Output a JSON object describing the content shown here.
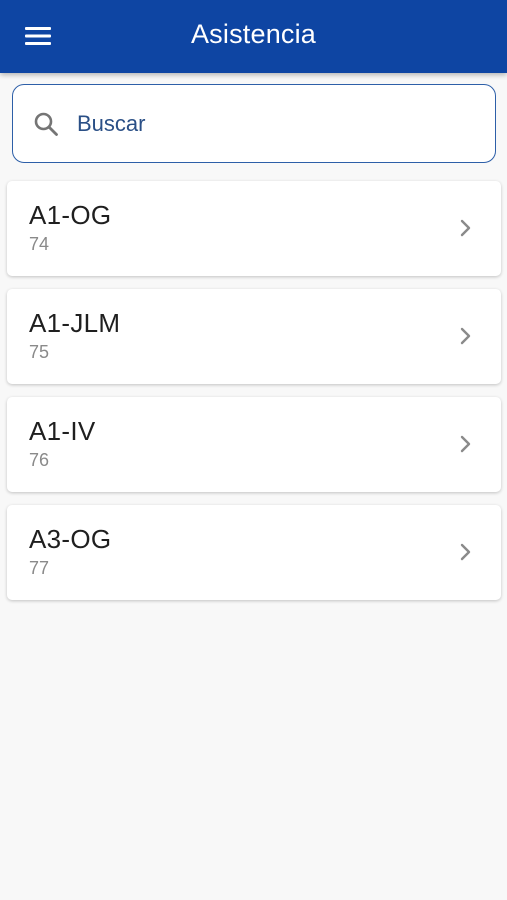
{
  "header": {
    "title": "Asistencia",
    "menu_icon": "hamburger-menu-icon",
    "background_color": "#0e45a3"
  },
  "search": {
    "placeholder": "Buscar",
    "value": "",
    "icon": "search-icon"
  },
  "list": {
    "items": [
      {
        "title": "A1-OG",
        "subtitle": "74"
      },
      {
        "title": "A1-JLM",
        "subtitle": "75"
      },
      {
        "title": "A1-IV",
        "subtitle": "76"
      },
      {
        "title": "A3-OG",
        "subtitle": "77"
      }
    ],
    "chevron_icon": "chevron-right-icon"
  }
}
